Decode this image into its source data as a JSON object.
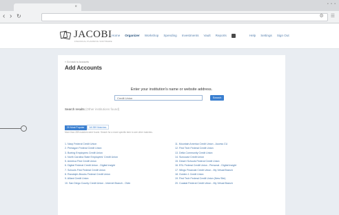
{
  "browser": {
    "tab_close": "×",
    "back": "‹",
    "forward": "›",
    "reload": "↻",
    "win_controls": "• • •",
    "nav_right": [
      "⚙",
      "☰"
    ]
  },
  "header": {
    "logo": "JACOBI",
    "logo_sub": "FINANCIAL PLANNING SOFTWARE",
    "nav": [
      "Home",
      "Organizer",
      "Workshop",
      "Spending",
      "Investments",
      "Vault",
      "Reports"
    ],
    "nav_right": [
      "Help",
      "Settings",
      "Sign Out"
    ]
  },
  "page": {
    "back_link": "« Go back to Accounts",
    "title": "Add Accounts",
    "prompt": "Enter your institution's name or website address.",
    "search_value": "Credit Union",
    "search_button": "Search",
    "results_heading": "Search results",
    "results_sub": "(Other institutions found)",
    "tab_popular": "20 Most Popular",
    "tab_all": "All 289 Matches",
    "note": "More than 289 matches were found. Search for a more specific term to see other matches."
  },
  "results_left": [
    "1. Navy Federal Credit Union",
    "2. Pentagon Federal Credit Union",
    "3. Boeing Employees Credit Union",
    "4. North Carolina State Employees' Credit Union",
    "5. America First Credit Union",
    "6. Digital Federal Credit Union - Digital Insight",
    "7. Schools First Federal Credit Union",
    "8. Randolph-Brooks Federal Credit Union",
    "9. Alliant Credit Union",
    "10. San Diego County Credit Union - Internet Branch - Olvin"
  ],
  "results_right": [
    "11. Mountain America Credit Union - Access CU",
    "12. First Tech Federal Credit Union",
    "13. Delta Community Credit Union",
    "14. Suncoast Credit Union",
    "15. Desert Schools Federal Credit Union",
    "16. ESL Federal Credit Union - Personal - Digital Insight",
    "17. Wings Financial Credit Union - My Virtual Branch",
    "18. Golden 1 Credit Union",
    "19. First Tech Federal Credit Union (New Site)",
    "20. Coastal Federal Credit Union - My Virtual Branch"
  ],
  "colors": {
    "link": "#3a6fa8",
    "accent": "#3a7fd0",
    "nav": "#5a83b0"
  }
}
